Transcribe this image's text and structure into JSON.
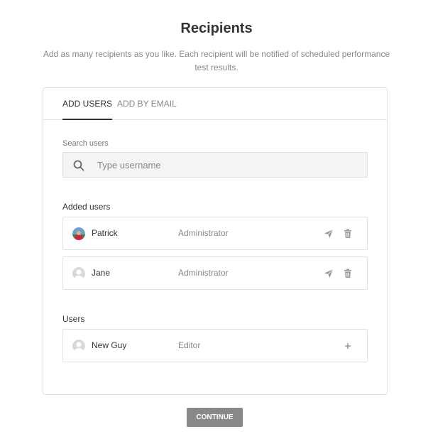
{
  "page": {
    "title": "Recipients",
    "subtitle": "Add as many recipients as you like. Each recipient will be notified of scheduled performance test results."
  },
  "tabs": [
    {
      "label": "ADD USERS",
      "active": true
    },
    {
      "label": "ADD BY EMAIL",
      "active": false
    }
  ],
  "search": {
    "label": "Search users",
    "placeholder": "Type username",
    "value": ""
  },
  "added_users": {
    "label": "Added users",
    "items": [
      {
        "name": "Patrick",
        "role": "Administrator",
        "avatar": "photo-avatar"
      },
      {
        "name": "Jane",
        "role": "Administrator",
        "avatar": "default-avatar"
      }
    ]
  },
  "users": {
    "label": "Users",
    "items": [
      {
        "name": "New Guy",
        "role": "Editor",
        "avatar": "default-avatar"
      }
    ]
  },
  "actions": {
    "continue_label": "CONTINUE"
  },
  "colors": {
    "accent_text": "#333333",
    "muted_text": "#888888",
    "border": "#e2e2e2",
    "button_bg": "#888888"
  }
}
